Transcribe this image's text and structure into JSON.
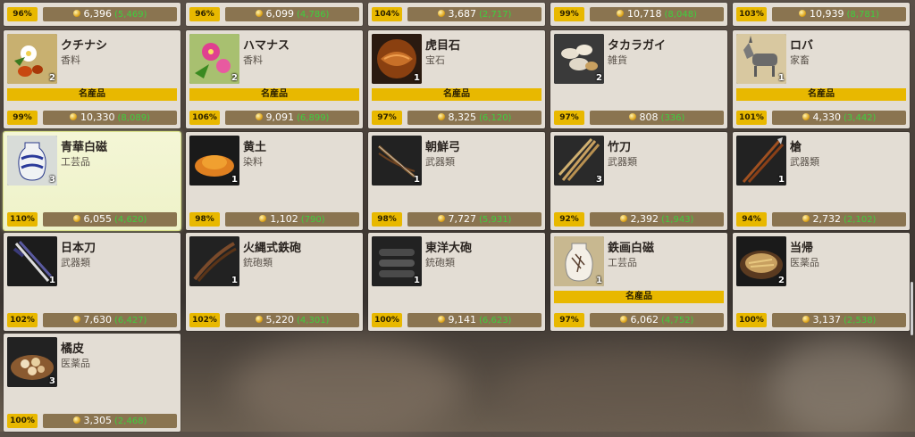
{
  "labels": {
    "meisanhin": "名産品"
  },
  "top_row": [
    {
      "pct": "96%",
      "price": "6,396",
      "base": "(5,469)"
    },
    {
      "pct": "96%",
      "price": "6,099",
      "base": "(4,786)"
    },
    {
      "pct": "104%",
      "price": "3,687",
      "base": "(2,717)"
    },
    {
      "pct": "99%",
      "price": "10,718",
      "base": "(8,048)"
    },
    {
      "pct": "103%",
      "price": "10,939",
      "base": "(8,781)"
    }
  ],
  "items": [
    {
      "name": "クチナシ",
      "category": "香料",
      "qty": "2",
      "meisan": true,
      "pct": "99%",
      "price": "10,330",
      "base": "(8,089)",
      "icon": "gardenia-icon"
    },
    {
      "name": "ハマナス",
      "category": "香料",
      "qty": "2",
      "meisan": true,
      "pct": "106%",
      "price": "9,091",
      "base": "(6,899)",
      "icon": "rose-icon"
    },
    {
      "name": "虎目石",
      "category": "宝石",
      "qty": "1",
      "meisan": true,
      "pct": "97%",
      "price": "8,325",
      "base": "(6,120)",
      "icon": "tigereye-icon"
    },
    {
      "name": "タカラガイ",
      "category": "雑貨",
      "qty": "2",
      "meisan": false,
      "pct": "97%",
      "price": "808",
      "base": "(336)",
      "icon": "cowrie-icon"
    },
    {
      "name": "ロバ",
      "category": "家畜",
      "qty": "1",
      "meisan": true,
      "pct": "101%",
      "price": "4,330",
      "base": "(3,442)",
      "icon": "donkey-icon"
    },
    {
      "name": "青華白磁",
      "category": "工芸品",
      "qty": "3",
      "meisan": false,
      "pct": "110%",
      "price": "6,055",
      "base": "(4,620)",
      "icon": "porcelain-icon",
      "selected": true
    },
    {
      "name": "黄土",
      "category": "染料",
      "qty": "1",
      "meisan": false,
      "pct": "98%",
      "price": "1,102",
      "base": "(790)",
      "icon": "ochre-icon"
    },
    {
      "name": "朝鮮弓",
      "category": "武器類",
      "qty": "1",
      "meisan": false,
      "pct": "98%",
      "price": "7,727",
      "base": "(5,931)",
      "icon": "bow-icon"
    },
    {
      "name": "竹刀",
      "category": "武器類",
      "qty": "3",
      "meisan": false,
      "pct": "92%",
      "price": "2,392",
      "base": "(1,943)",
      "icon": "shinai-icon"
    },
    {
      "name": "槍",
      "category": "武器類",
      "qty": "1",
      "meisan": false,
      "pct": "94%",
      "price": "2,732",
      "base": "(2,102)",
      "icon": "spear-icon"
    },
    {
      "name": "日本刀",
      "category": "武器類",
      "qty": "1",
      "meisan": false,
      "pct": "102%",
      "price": "7,630",
      "base": "(6,427)",
      "icon": "katana-icon"
    },
    {
      "name": "火縄式鉄砲",
      "category": "銃砲類",
      "qty": "1",
      "meisan": false,
      "pct": "102%",
      "price": "5,220",
      "base": "(4,301)",
      "icon": "matchlock-icon"
    },
    {
      "name": "東洋大砲",
      "category": "銃砲類",
      "qty": "1",
      "meisan": false,
      "pct": "100%",
      "price": "9,141",
      "base": "(6,623)",
      "icon": "cannon-icon"
    },
    {
      "name": "鉄画白磁",
      "category": "工芸品",
      "qty": "1",
      "meisan": true,
      "pct": "97%",
      "price": "6,062",
      "base": "(4,752)",
      "icon": "vase-icon"
    },
    {
      "name": "当帰",
      "category": "医薬品",
      "qty": "2",
      "meisan": false,
      "pct": "100%",
      "price": "3,137",
      "base": "(2,538)",
      "icon": "angelica-icon"
    },
    {
      "name": "橘皮",
      "category": "医薬品",
      "qty": "3",
      "meisan": false,
      "pct": "100%",
      "price": "3,305",
      "base": "(2,468)",
      "icon": "citrus-peel-icon"
    }
  ],
  "colors": {
    "gold": "#e8b800",
    "pricebg": "#8a7450",
    "basegreen": "#3ecf3e",
    "card": "#e3ddd4"
  }
}
